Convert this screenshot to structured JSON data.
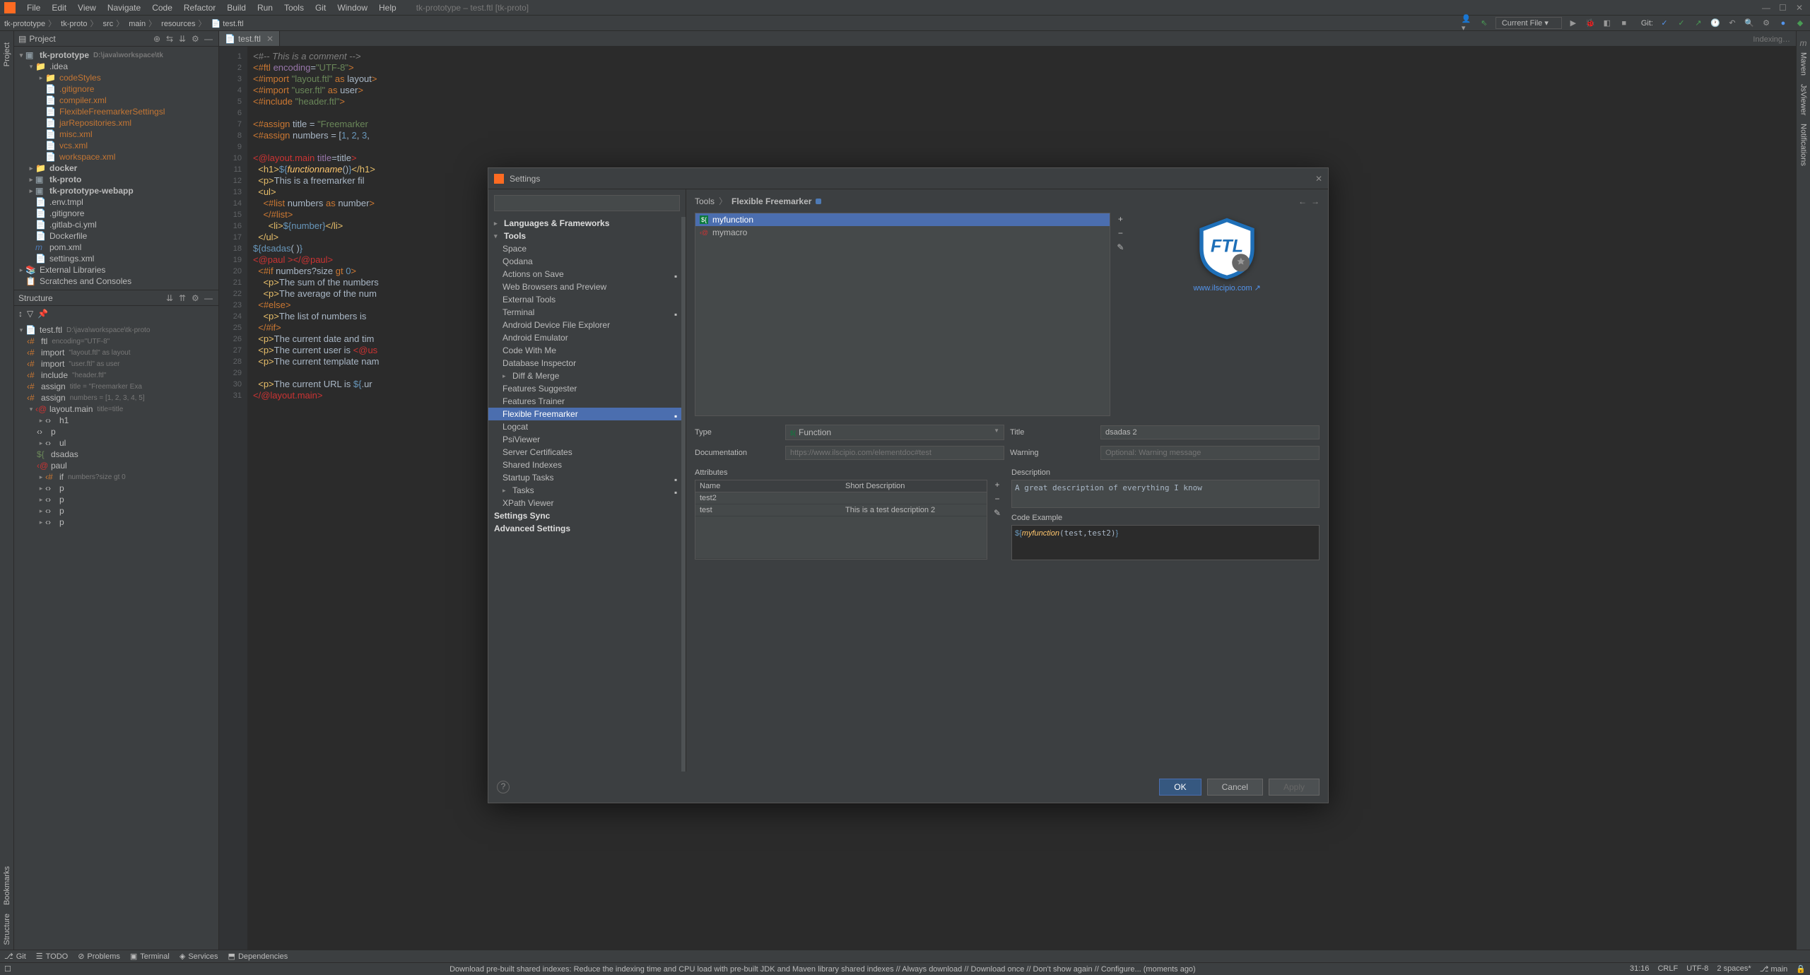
{
  "window": {
    "title": "tk-prototype – test.ftl [tk-proto]"
  },
  "menu": [
    "File",
    "Edit",
    "View",
    "Navigate",
    "Code",
    "Refactor",
    "Build",
    "Run",
    "Tools",
    "Git",
    "Window",
    "Help"
  ],
  "breadcrumb": [
    "tk-prototype",
    "tk-proto",
    "src",
    "main",
    "resources",
    "test.ftl"
  ],
  "toolbar": {
    "run_config": "Current File",
    "git_label": "Git:"
  },
  "project_panel": {
    "title": "Project",
    "root": {
      "name": "tk-prototype",
      "path": "D:\\java\\workspace\\tk"
    },
    "idea_folder": ".idea",
    "idea_children": [
      "codeStyles",
      ".gitignore",
      "compiler.xml",
      "FlexibleFreemarkerSettingsl",
      "jarRepositories.xml",
      "misc.xml",
      "vcs.xml",
      "workspace.xml"
    ],
    "modules": [
      "docker",
      "tk-proto",
      "tk-prototype-webapp"
    ],
    "root_files": [
      ".env.tmpl",
      ".gitignore",
      ".gitlab-ci.yml",
      "Dockerfile",
      "pom.xml",
      "settings.xml"
    ],
    "external": "External Libraries",
    "scratches": "Scratches and Consoles"
  },
  "structure_panel": {
    "title": "Structure",
    "file": {
      "name": "test.ftl",
      "path": "D:\\java\\workspace\\tk-proto"
    },
    "items": [
      {
        "t": "ftl",
        "hint": "encoding=\"UTF-8\""
      },
      {
        "t": "import",
        "hint": "\"layout.ftl\" as layout"
      },
      {
        "t": "import",
        "hint": "\"user.ftl\" as user"
      },
      {
        "t": "include",
        "hint": "\"header.ftl\""
      },
      {
        "t": "assign",
        "hint": "title = \"Freemarker Exa"
      },
      {
        "t": "assign",
        "hint": "numbers = [1, 2, 3, 4, 5]"
      },
      {
        "t": "layout.main",
        "hint": "title=title"
      },
      {
        "t": "h1"
      },
      {
        "t": "p"
      },
      {
        "t": "ul"
      },
      {
        "t": "dsadas"
      },
      {
        "t": "paul"
      },
      {
        "t": "if",
        "hint": "numbers?size gt 0"
      },
      {
        "t": "p"
      },
      {
        "t": "p"
      },
      {
        "t": "p"
      },
      {
        "t": "p"
      }
    ]
  },
  "editor": {
    "filename": "test.ftl",
    "indexing": "Indexing…",
    "lines": 31
  },
  "bottom_tools": [
    "Git",
    "TODO",
    "Problems",
    "Terminal",
    "Services",
    "Dependencies"
  ],
  "statusbar": {
    "message": "Download pre-built shared indexes: Reduce the indexing time and CPU load with pre-built JDK and Maven library shared indexes // Always download // Download once // Don't show again // Configure... (moments ago)",
    "pos": "31:16",
    "line_ending": "CRLF",
    "encoding": "UTF-8",
    "indent": "2 spaces*",
    "branch": "main"
  },
  "left_rail": [
    "Project",
    "Bookmarks",
    "Structure"
  ],
  "right_rail": [
    "m",
    "Maven",
    "JsViewer",
    "Notifications"
  ],
  "settings_dialog": {
    "title": "Settings",
    "search_placeholder": "",
    "breadcrumb": [
      "Tools",
      "Flexible Freemarker"
    ],
    "tree": {
      "group1": "Languages & Frameworks",
      "group2": "Tools",
      "tools_children": [
        "Space",
        "Qodana",
        "Actions on Save",
        "Web Browsers and Preview",
        "External Tools",
        "Terminal",
        "Android Device File Explorer",
        "Android Emulator",
        "Code With Me",
        "Database Inspector",
        "Diff & Merge",
        "Features Suggester",
        "Features Trainer",
        "Flexible Freemarker",
        "Logcat",
        "PsiViewer",
        "Server Certificates",
        "Shared Indexes",
        "Startup Tasks",
        "Tasks",
        "XPath Viewer"
      ],
      "settings_sync": "Settings Sync",
      "advanced": "Advanced Settings"
    },
    "elements": [
      {
        "name": "myfunction",
        "kind": "function"
      },
      {
        "name": "mymacro",
        "kind": "macro"
      }
    ],
    "logo_link": "www.ilscipio.com ↗",
    "detail": {
      "type_label": "Type",
      "type_value": "Function",
      "title_label": "Title",
      "title_value": "dsadas 2",
      "doc_label": "Documentation",
      "doc_placeholder": "https://www.ilscipio.com/elementdoc#test",
      "warn_label": "Warning",
      "warn_placeholder": "Optional: Warning message"
    },
    "attributes": {
      "label": "Attributes",
      "headers": [
        "Name",
        "Short Description"
      ],
      "rows": [
        {
          "name": "test2",
          "desc": ""
        },
        {
          "name": "test",
          "desc": "This is a test description 2"
        }
      ]
    },
    "description": {
      "label": "Description",
      "value": "A great description of everything I know"
    },
    "code_example": {
      "label": "Code Example",
      "value": "${myfunction(test,test2)}"
    },
    "buttons": {
      "ok": "OK",
      "cancel": "Cancel",
      "apply": "Apply"
    }
  }
}
